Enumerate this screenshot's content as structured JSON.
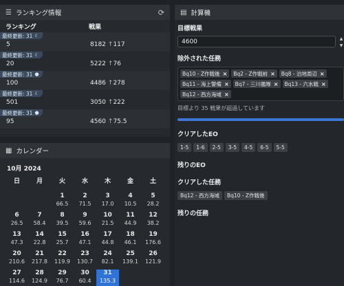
{
  "ranking": {
    "title": "ランキング情報",
    "col_rank": "ランキング",
    "col_score": "戦果",
    "rows": [
      {
        "badge": "最終更新: 31",
        "badge_icon": "☾",
        "rank": "5",
        "score": "8182",
        "delta": "117"
      },
      {
        "badge": "最終更新: 31",
        "badge_icon": "☾",
        "rank": "20",
        "score": "5222",
        "delta": "76"
      },
      {
        "badge": "最終更新: 31",
        "badge_icon": "●",
        "rank": "100",
        "score": "4486",
        "delta": "278"
      },
      {
        "badge": "最終更新: 31",
        "badge_icon": "☾",
        "rank": "501",
        "score": "3050",
        "delta": "222"
      },
      {
        "badge": "最終更新: 31",
        "badge_icon": "●",
        "rank": "95",
        "score": "4560",
        "delta": "75.5"
      }
    ]
  },
  "calendar": {
    "title": "カレンダー",
    "month": "10月 2024",
    "dow": [
      "日",
      "月",
      "火",
      "水",
      "木",
      "金",
      "土"
    ],
    "days": [
      {
        "d": "",
        "v": ""
      },
      {
        "d": "",
        "v": ""
      },
      {
        "d": "1",
        "v": "66.5"
      },
      {
        "d": "2",
        "v": "71.5"
      },
      {
        "d": "3",
        "v": "17.0"
      },
      {
        "d": "4",
        "v": "10.5"
      },
      {
        "d": "5",
        "v": "28.2"
      },
      {
        "d": "6",
        "v": "26.5"
      },
      {
        "d": "7",
        "v": "58.4"
      },
      {
        "d": "8",
        "v": "39.5"
      },
      {
        "d": "9",
        "v": "59.6"
      },
      {
        "d": "10",
        "v": "21.5"
      },
      {
        "d": "11",
        "v": "44.9"
      },
      {
        "d": "12",
        "v": "38.2"
      },
      {
        "d": "13",
        "v": "47.3"
      },
      {
        "d": "14",
        "v": "22.8"
      },
      {
        "d": "15",
        "v": "25.7"
      },
      {
        "d": "16",
        "v": "47.1"
      },
      {
        "d": "17",
        "v": "44.8"
      },
      {
        "d": "18",
        "v": "46.1"
      },
      {
        "d": "19",
        "v": "176.6"
      },
      {
        "d": "20",
        "v": "210.6"
      },
      {
        "d": "21",
        "v": "217.8"
      },
      {
        "d": "22",
        "v": "119.9"
      },
      {
        "d": "23",
        "v": "130.7"
      },
      {
        "d": "24",
        "v": "82.1"
      },
      {
        "d": "25",
        "v": "139.1"
      },
      {
        "d": "26",
        "v": "121.9"
      },
      {
        "d": "27",
        "v": "114.6"
      },
      {
        "d": "28",
        "v": "124.9"
      },
      {
        "d": "29",
        "v": "76.7"
      },
      {
        "d": "30",
        "v": "60.4"
      },
      {
        "d": "31",
        "v": "135.3"
      }
    ],
    "selected_day": "31"
  },
  "calculator": {
    "title": "計算機",
    "target_label": "目標戦果",
    "target_value": "4600",
    "excluded_label": "除外された任務",
    "excluded_tags": [
      "Bq10 - Z作戦後",
      "Bq2 - Z作戦前",
      "Bq8 - 泊地周辺",
      "Bq11 - 海上警備",
      "Bq7 - 三川艦隊",
      "Bq13 - 六水戦",
      "Bq12 - 西方海域"
    ],
    "note": "目標より 35 戦果が超過しています",
    "progress": 1.0,
    "cleared_eo_label": "クリアしたEO",
    "cleared_eo": [
      "1-5",
      "1-6",
      "2-5",
      "3-5",
      "4-5",
      "6-5",
      "5-5"
    ],
    "remaining_eo_label": "残りのEO",
    "cleared_quests_label": "クリアした任務",
    "cleared_quests": [
      "Bq12 - 西方海域",
      "Bq10 - Z作戦後"
    ],
    "remaining_quests_label": "残りの任務"
  },
  "colors": {
    "accent": "#2f73d6",
    "progress": "#3d76d6",
    "badge": "#3a4a5c"
  }
}
